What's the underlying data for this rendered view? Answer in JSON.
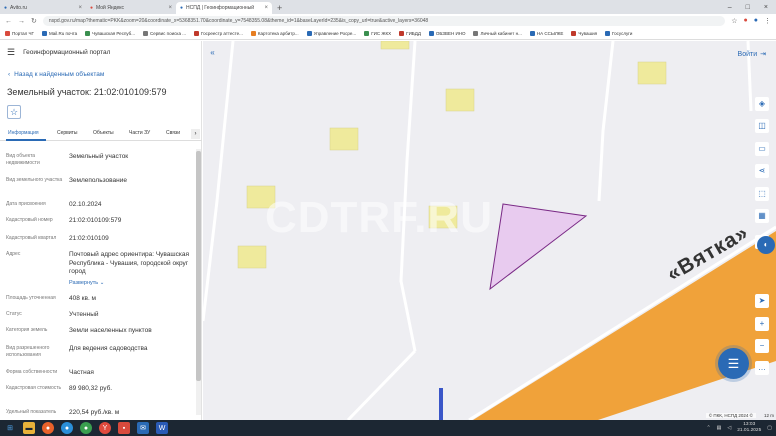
{
  "browser": {
    "tabs": [
      {
        "label": "Avito.ru",
        "icon": "avito-icon"
      },
      {
        "label": "Мой Яндекс",
        "icon": "yandex-icon"
      },
      {
        "label": "НСПД | Геоинформационный",
        "icon": "map-tab-icon"
      }
    ],
    "new_tab": "+",
    "window_controls": [
      "–",
      "□",
      "×"
    ],
    "url": "nspd.gov.ru/map?thematic=PKK&zoom=20&coordinate_x=5368351.70&coordinate_y=7548355.08&theme_id=1&baseLayerId=235&is_copy_url=true&active_layers=36048",
    "bookmarks": [
      {
        "label": "Портал ЧГ",
        "color": "#d94a3d"
      },
      {
        "label": "Mail.Ru почта",
        "color": "#2a6ab5"
      },
      {
        "label": "Чувашская Респуб...",
        "color": "#3a8f4f"
      },
      {
        "label": "Сервис поиска ...",
        "color": "#777777"
      },
      {
        "label": "Госреестр аттесте...",
        "color": "#c0392b"
      },
      {
        "label": "Картотека арбитр...",
        "color": "#e67e22"
      },
      {
        "label": "Управление Росре...",
        "color": "#2a6ab5"
      },
      {
        "label": "ГИС ЖКХ",
        "color": "#3a8f4f"
      },
      {
        "label": "ГИБДД",
        "color": "#c0392b"
      },
      {
        "label": "ОБЗВЕН ИНО",
        "color": "#2a6ab5"
      },
      {
        "label": "Личный кабинет н...",
        "color": "#777777"
      },
      {
        "label": "НА ССЫЛКЕ",
        "color": "#2a6ab5"
      },
      {
        "label": "Чувашия",
        "color": "#c0392b"
      },
      {
        "label": "Госуслуги",
        "color": "#2a6ab5"
      }
    ]
  },
  "panel": {
    "app_title": "Геоинформационный портал",
    "back_link": "Назад к найденным объектам",
    "title": "Земельный участок: 21:02:010109:579",
    "tabs": [
      "Информация",
      "Сервиты",
      "Объекты",
      "Части ЗУ",
      "Связи"
    ],
    "rows": [
      {
        "label": "Вид объекта недвижимости",
        "value": "Земельный участок"
      },
      {
        "label": "Вид земельного участка",
        "value": "Землепользование"
      },
      {
        "label": "Дата присвоения",
        "value": "02.10.2024"
      },
      {
        "label": "Кадастровый номер",
        "value": "21:02:010109:579"
      },
      {
        "label": "Кадастровый квартал",
        "value": "21:02:010109"
      },
      {
        "label": "Адрес",
        "value": "Почтовый адрес ориентира: Чувашская Республика - Чувашия, городской округ город",
        "extra": "Развернуть"
      },
      {
        "label": "Площадь уточненная",
        "value": "408 кв. м"
      },
      {
        "label": "Статус",
        "value": "Учтенный"
      },
      {
        "label": "Категория земель",
        "value": "Земли населенных пунктов"
      },
      {
        "label": "Вид разрешенного использования",
        "value": "Для ведения садоводства"
      },
      {
        "label": "Форма собственности",
        "value": "Частная"
      },
      {
        "label": "Кадастровая стоимость",
        "value": "89 980,32 руб."
      },
      {
        "label": "Удельный показатель",
        "value": "220,54 руб./кв. м"
      }
    ]
  },
  "map": {
    "street_label": "«Вятка»",
    "watermark": "CDTRF.RU",
    "login_label": "Войти",
    "copyright": "© ПКК, НСПД 2024 ©",
    "scale": "12 m",
    "colors": {
      "road": "#f0a23a",
      "building": "#efea9c",
      "parcel_fill": "#e6c4ee",
      "parcel_stroke": "#7a2a86",
      "accent": "#2a6ab5"
    }
  },
  "taskbar": {
    "time": "13:03",
    "date": "21.01.2025"
  }
}
